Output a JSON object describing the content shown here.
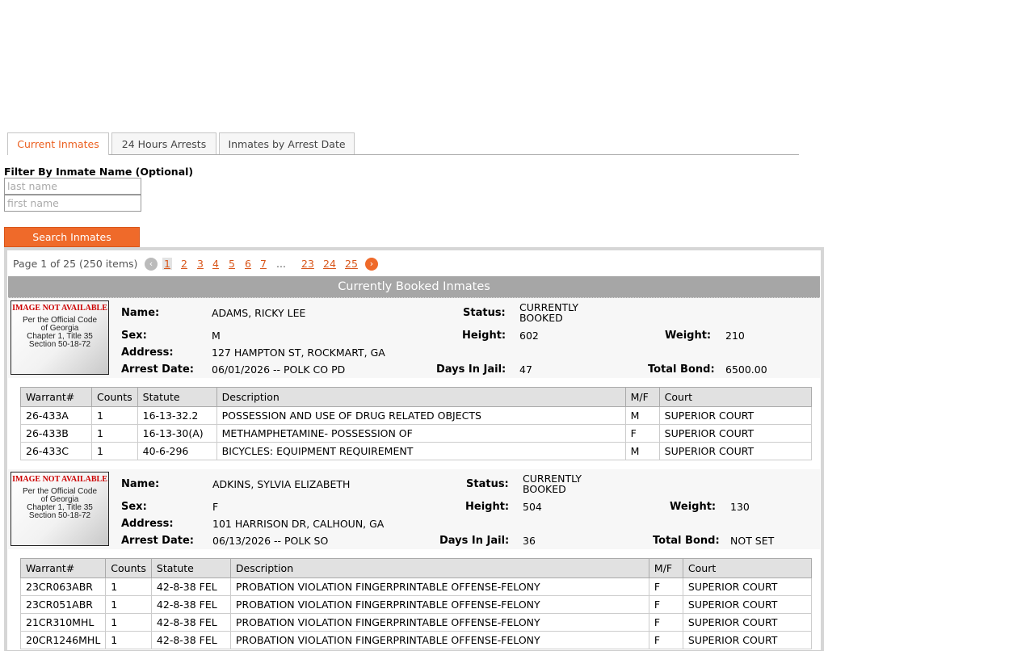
{
  "tabs": [
    "Current Inmates",
    "24 Hours Arrests",
    "Inmates by Arrest Date"
  ],
  "filter": {
    "label": "Filter By Inmate Name (Optional)",
    "last_placeholder": "last name",
    "first_placeholder": "first name",
    "search_label": "Search Inmates"
  },
  "pager": {
    "info": "Page 1 of 25 (250 items)",
    "prev_icon": "chevron-left-icon",
    "next_icon": "chevron-right-icon",
    "pages": [
      "1",
      "2",
      "3",
      "4",
      "5",
      "6",
      "7",
      "...",
      "23",
      "24",
      "25"
    ],
    "current": "1"
  },
  "grid_title": "Currently Booked Inmates",
  "placeholder_image": {
    "title": "IMAGE NOT AVAILABLE",
    "lines": [
      "Per the Official Code",
      "of Georgia",
      "Chapter 1, Title 35",
      "Section 50-18-72"
    ]
  },
  "field_labels": {
    "name": "Name:",
    "sex": "Sex:",
    "address": "Address:",
    "arrest_date": "Arrest Date:",
    "status": "Status:",
    "height": "Height:",
    "weight": "Weight:",
    "days": "Days In Jail:",
    "bond": "Total Bond:"
  },
  "warrant_headers": [
    "Warrant#",
    "Counts",
    "Statute",
    "Description",
    "M/F",
    "Court"
  ],
  "inmates": [
    {
      "name": "ADAMS, RICKY LEE",
      "sex": "M",
      "address": "127 HAMPTON ST, ROCKMART, GA",
      "arrest_date": "06/01/2026 -- POLK CO PD",
      "status": "CURRENTLY BOOKED",
      "height": "602",
      "weight": "210",
      "days": "47",
      "bond": "6500.00",
      "warrants": [
        [
          "26-433A",
          "1",
          "16-13-32.2",
          "POSSESSION AND USE OF DRUG RELATED OBJECTS",
          "M",
          "SUPERIOR COURT"
        ],
        [
          "26-433B",
          "1",
          "16-13-30(A)",
          "METHAMPHETAMINE- POSSESSION OF",
          "F",
          "SUPERIOR COURT"
        ],
        [
          "26-433C",
          "1",
          "40-6-296",
          "BICYCLES: EQUIPMENT REQUIREMENT",
          "M",
          "SUPERIOR COURT"
        ]
      ]
    },
    {
      "name": "ADKINS, SYLVIA ELIZABETH",
      "sex": "F",
      "address": "101 HARRISON DR, CALHOUN, GA",
      "arrest_date": "06/13/2026 -- POLK SO",
      "status": "CURRENTLY BOOKED",
      "height": "504",
      "weight": "130",
      "days": "36",
      "bond": "NOT SET",
      "warrants": [
        [
          "23CR063ABR",
          "1",
          "42-8-38 FEL",
          "PROBATION VIOLATION FINGERPRINTABLE OFFENSE-FELONY",
          "F",
          "SUPERIOR COURT"
        ],
        [
          "23CR051ABR",
          "1",
          "42-8-38 FEL",
          "PROBATION VIOLATION FINGERPRINTABLE OFFENSE-FELONY",
          "F",
          "SUPERIOR COURT"
        ],
        [
          "21CR310MHL",
          "1",
          "42-8-38 FEL",
          "PROBATION VIOLATION FINGERPRINTABLE OFFENSE-FELONY",
          "F",
          "SUPERIOR COURT"
        ],
        [
          "20CR1246MHL",
          "1",
          "42-8-38 FEL",
          "PROBATION VIOLATION FINGERPRINTABLE OFFENSE-FELONY",
          "F",
          "SUPERIOR COURT"
        ]
      ]
    }
  ]
}
